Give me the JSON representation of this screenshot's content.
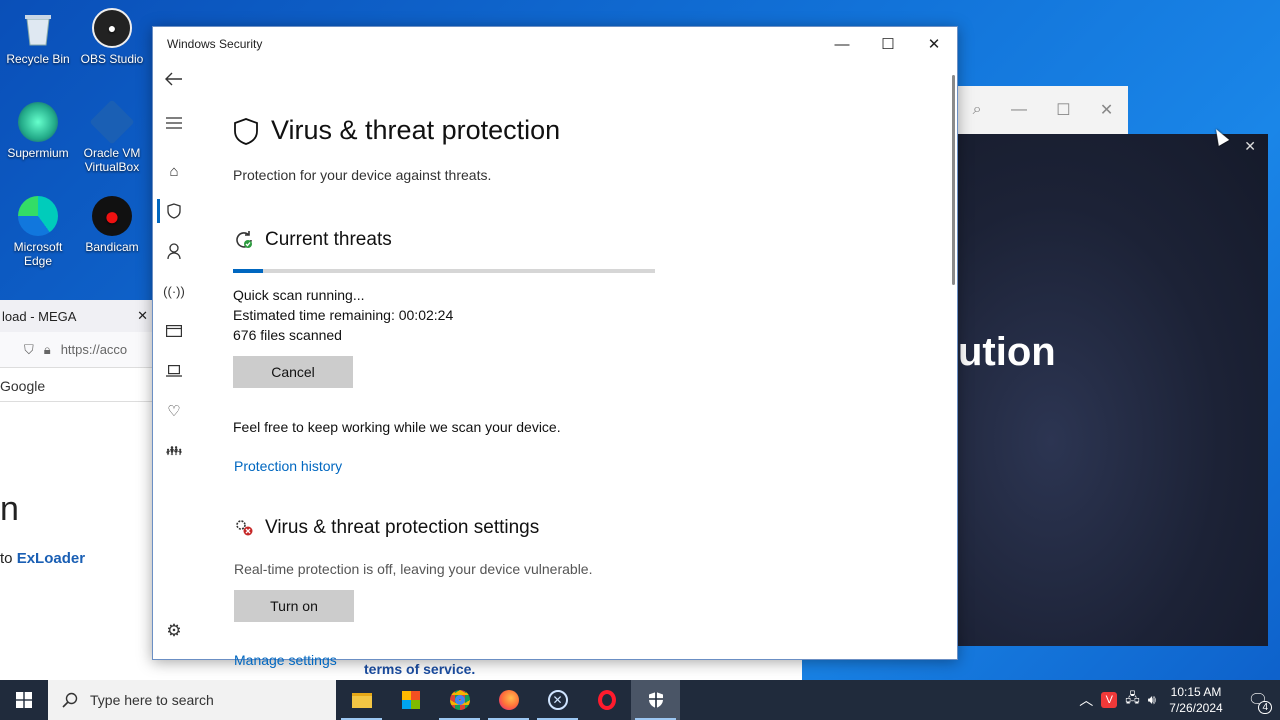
{
  "desktop": {
    "icons": [
      {
        "label": "Recycle Bin",
        "icon": "recycle-bin-icon"
      },
      {
        "label": "OBS Studio",
        "icon": "obs-icon"
      },
      {
        "label": "Supermium",
        "icon": "supermium-icon"
      },
      {
        "label": "Oracle VM VirtualBox",
        "icon": "virtualbox-icon"
      },
      {
        "label": "Microsoft Edge",
        "icon": "edge-icon"
      },
      {
        "label": "Bandicam",
        "icon": "bandicam-icon"
      }
    ]
  },
  "bg_browser": {
    "tab_title": "load - MEGA",
    "url": "https://acco",
    "search_engine": "Google",
    "heading_fragment": "n",
    "text_prefix": "to",
    "link": "ExLoader",
    "footer_link": "terms of service."
  },
  "bg_app": {
    "text_fragment": "ution"
  },
  "window": {
    "title": "Windows Security",
    "page_title": "Virus & threat protection",
    "page_subtitle": "Protection for your device against threats.",
    "current_threats": {
      "title": "Current threats",
      "progress_percent": 7,
      "status": "Quick scan running...",
      "time_remaining": "Estimated time remaining:  00:02:24",
      "files_scanned": "676  files scanned",
      "cancel_label": "Cancel",
      "note": "Feel free to keep working while we scan your device.",
      "history_link": "Protection history"
    },
    "settings": {
      "title": "Virus & threat protection settings",
      "status": "Real-time protection is off, leaving your device vulnerable.",
      "turn_on_label": "Turn on",
      "manage_link": "Manage settings"
    }
  },
  "taskbar": {
    "search_placeholder": "Type here to search",
    "apps": [
      "file-explorer-icon",
      "store-icon",
      "chrome-icon",
      "firefox-icon",
      "app-icon",
      "opera-icon",
      "windows-security-icon"
    ],
    "time": "10:15 AM",
    "date": "7/26/2024",
    "notification_count": "4"
  },
  "colors": {
    "accent": "#0067c0",
    "taskbar": "#202b3c",
    "button": "#cccccc"
  }
}
